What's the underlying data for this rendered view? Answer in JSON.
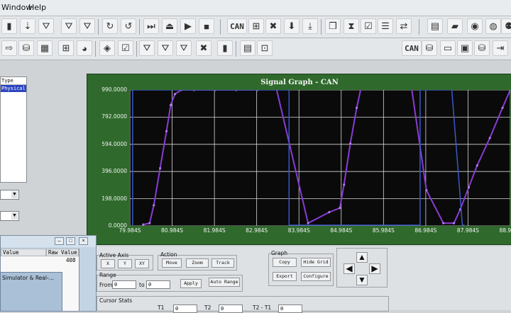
{
  "menu": {
    "window": "Window",
    "help": "Help"
  },
  "toolbar1": {
    "can_label": "CAN"
  },
  "toolbar2": {
    "can_label": "CAN"
  },
  "left_panel": {
    "header": "Type",
    "selected": "Physical"
  },
  "graph": {
    "title": "Signal Graph - CAN",
    "y_ticks": [
      "990.0000",
      "792.0000",
      "594.0000",
      "396.0000",
      "198.0000",
      "0.0000"
    ],
    "x_ticks": [
      "79.984S",
      "80.984S",
      "81.984S",
      "82.984S",
      "83.984S",
      "84.984S",
      "85.984S",
      "86.984S",
      "87.984S",
      "88.984S"
    ]
  },
  "chart_data": {
    "type": "line",
    "title": "Signal Graph - CAN",
    "ylim": [
      0,
      990
    ],
    "xlim": [
      79.984,
      88.984
    ],
    "grid": true,
    "series": [
      {
        "color": "#8a3bd6",
        "x": [
          80.3,
          80.45,
          80.55,
          80.7,
          80.85,
          80.95,
          81.05,
          81.2,
          81.5,
          82.0,
          82.5,
          83.0,
          83.3,
          83.45,
          84.2,
          84.7,
          84.95,
          85.05,
          85.2,
          85.35,
          85.45,
          85.6,
          86.0,
          86.65,
          87.0,
          87.4,
          87.65,
          87.8,
          88.0,
          88.2,
          88.5,
          88.8,
          88.984
        ],
        "y": [
          10,
          20,
          150,
          420,
          690,
          880,
          960,
          990,
          990,
          990,
          990,
          990,
          1000,
          1000,
          20,
          100,
          130,
          300,
          600,
          860,
          1000,
          1000,
          1000,
          1000,
          260,
          20,
          20,
          120,
          280,
          440,
          640,
          860,
          990
        ]
      },
      {
        "color": "#3a58c8",
        "x": [
          80.05,
          80.05,
          80.9,
          81.05,
          81.1,
          83.75,
          83.75,
          86.85,
          86.85,
          87.6,
          87.85,
          87.9
        ],
        "y": [
          5,
          990,
          990,
          990,
          990,
          990,
          5,
          5,
          990,
          990,
          5,
          5
        ]
      }
    ]
  },
  "dialog": {
    "col_value": "Value",
    "col_raw": "Raw Value",
    "raw_value": "408",
    "sim_title": "Simulator & Real-..."
  },
  "active_axis": {
    "label": "Active Axis",
    "x": "X",
    "y": "Y",
    "xy": "XY"
  },
  "action": {
    "label": "Action",
    "move": "Move",
    "zoom": "Zoom",
    "track": "Track"
  },
  "range": {
    "label": "Range",
    "from": "From",
    "from_value": "0",
    "to": "to",
    "to_value": "0",
    "apply": "Apply",
    "auto_range": "Auto Range"
  },
  "graph_group": {
    "label": "Graph",
    "copy": "Copy",
    "hide_grid": "Hide Grid",
    "export": "Export",
    "configure": "Configure"
  },
  "cursor_stats": {
    "label": "Cursor Stats",
    "t1": "T1",
    "t1_value": "0",
    "t2": "T2",
    "t2_value": "0",
    "diff": "T2 - T1",
    "diff_value": "0"
  }
}
